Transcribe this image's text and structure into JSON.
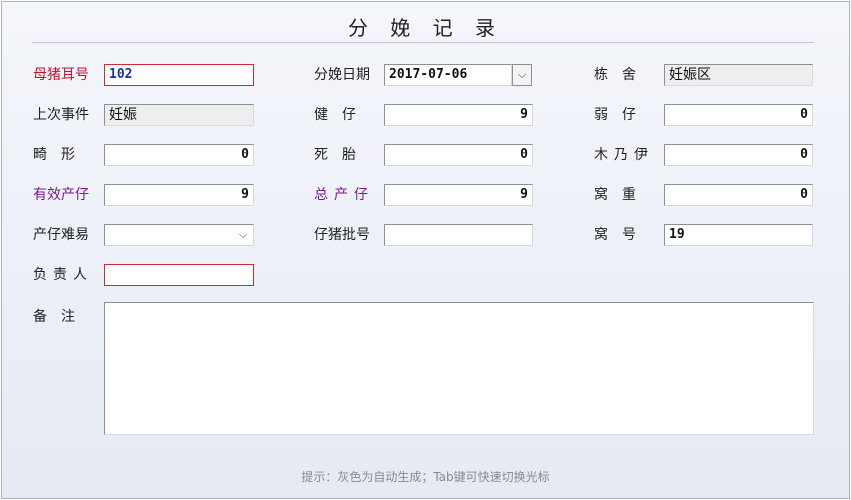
{
  "title": "分 娩 记 录",
  "colors": {
    "required": "#c8102e",
    "highlight": "#7b1a8a",
    "value_blue": "#1a2fb0"
  },
  "fields": {
    "sow_ear": {
      "label": "母猪耳号",
      "value": "102"
    },
    "birth_date": {
      "label": "分娩日期",
      "value": "2017-07-06"
    },
    "barn": {
      "label": "栋　舍",
      "value": "妊娠区"
    },
    "last_event": {
      "label": "上次事件",
      "value": "妊娠"
    },
    "healthy": {
      "label": "健　仔",
      "value": "9"
    },
    "weak": {
      "label": "弱　仔",
      "value": "0"
    },
    "deformed": {
      "label": "畸　形",
      "value": "0"
    },
    "stillborn": {
      "label": "死　胎",
      "value": "0"
    },
    "mummy": {
      "label": "木乃伊",
      "value": "0"
    },
    "effective": {
      "label": "有效产仔",
      "value": "9"
    },
    "total": {
      "label": "总产仔",
      "value": "9"
    },
    "litter_weight": {
      "label": "窝　重",
      "value": "0"
    },
    "difficulty": {
      "label": "产仔难易",
      "value": ""
    },
    "batch": {
      "label": "仔猪批号",
      "value": ""
    },
    "litter_no": {
      "label": "窝　号",
      "value": "19"
    },
    "responsible": {
      "label": "负责人",
      "value": ""
    },
    "notes": {
      "label": "备　注",
      "value": ""
    }
  },
  "hint": "提示：灰色为自动生成；Tab键可快速切换光标"
}
